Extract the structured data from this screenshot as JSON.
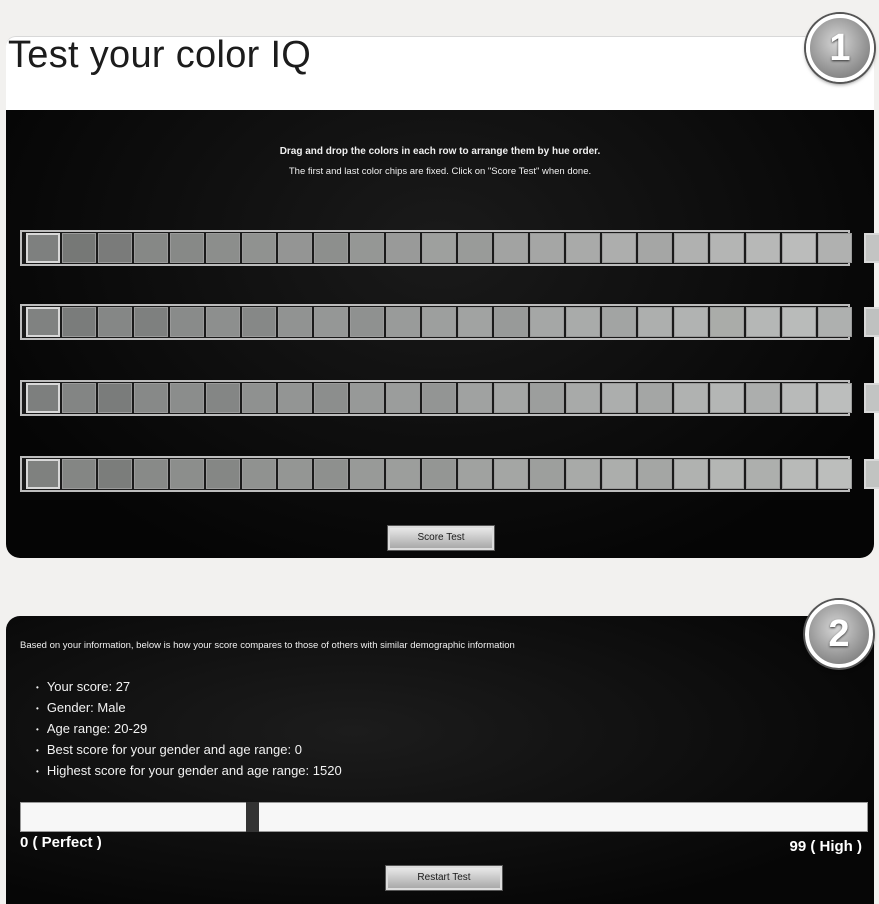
{
  "header": {
    "title": "Test your color IQ"
  },
  "badges": {
    "step1": "1",
    "step2": "2"
  },
  "test": {
    "instruction_line1": "Drag and drop the colors in each row to arrange them by hue order.",
    "instruction_line2": "The first and last color chips are fixed. Click on \"Score Test\" when done.",
    "rows": [
      {
        "chips": [
          "#7e807f",
          "#767876",
          "#7a7b7a",
          "#868886",
          "#878987",
          "#8c8e8c",
          "#909290",
          "#949594",
          "#8d8f8d",
          "#959795",
          "#999a99",
          "#9ea09e",
          "#999b99",
          "#a2a3a2",
          "#a5a6a5",
          "#a9aaa9",
          "#adaead",
          "#a5a6a5",
          "#b0b1b0",
          "#b4b5b4",
          "#b7b8b7",
          "#bbbcbb",
          "#b0b1b0",
          "#c3c4c3"
        ]
      },
      {
        "chips": [
          "#808281",
          "#7a7c7b",
          "#858786",
          "#7e807f",
          "#898b8a",
          "#8d8f8e",
          "#868887",
          "#919392",
          "#959796",
          "#8f9190",
          "#999b9a",
          "#9d9f9e",
          "#a1a3a2",
          "#989a99",
          "#a5a7a6",
          "#a9abaa",
          "#a2a4a3",
          "#adafae",
          "#b1b3b2",
          "#aaaca9",
          "#b5b7b6",
          "#b9bbba",
          "#aeb0af",
          "#bfc1c0"
        ]
      },
      {
        "chips": [
          "#7d7f7e",
          "#838584",
          "#7a7c7b",
          "#878988",
          "#8b8d8c",
          "#848685",
          "#8f9190",
          "#939594",
          "#8c8e8d",
          "#979998",
          "#9b9d9c",
          "#939594",
          "#a0a2a1",
          "#a4a6a5",
          "#9c9e9d",
          "#a8aaa9",
          "#acaead",
          "#a4a6a5",
          "#b0b2b1",
          "#b4b6b5",
          "#acaead",
          "#b8bab9",
          "#bcbebd",
          "#c2c4c3"
        ]
      },
      {
        "chips": [
          "#7f817f",
          "#848684",
          "#7b7d7b",
          "#888a88",
          "#8c8e8c",
          "#858785",
          "#909290",
          "#949694",
          "#8e908e",
          "#989a98",
          "#9c9e9c",
          "#949694",
          "#a0a2a0",
          "#a4a6a4",
          "#9d9f9d",
          "#a8aaa8",
          "#acaeac",
          "#a4a6a4",
          "#b0b2b0",
          "#b4b6b4",
          "#adafad",
          "#b8bab8",
          "#bcbebc",
          "#c1c3c1"
        ]
      }
    ],
    "score_button": "Score Test"
  },
  "results": {
    "intro": "Based on your information, below is how your score compares to those of others with similar demographic information",
    "items": [
      "Your score: 27",
      "Gender: Male",
      "Age range: 20-29",
      "Best score for your gender and age range: 0",
      "Highest score for your gender and age range: 1520"
    ],
    "score_fraction": 0.27,
    "scale_min_label": "0 ( Perfect )",
    "scale_max_label": "99 ( High )",
    "restart_button": "Restart Test"
  }
}
